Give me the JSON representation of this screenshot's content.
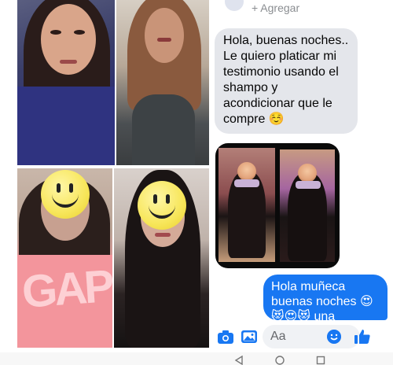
{
  "chat": {
    "add_label": "+ Agregar",
    "incoming_message": "Hola, buenas noches.. Le quiero platicar mi testimonio usando el shampo y acondicionar que le compre ☺️",
    "outgoing_message": "Hola muñeca buenas noches 😍😻😍😻 una",
    "composer_placeholder": "Aa"
  },
  "collage": {
    "shirt_text": "GAP"
  },
  "colors": {
    "messenger_blue": "#1877f2",
    "incoming_bubble": "#e4e6eb"
  },
  "icons": [
    "camera-icon",
    "gallery-icon",
    "emoji-icon",
    "like-icon",
    "nav-back-icon",
    "nav-home-icon",
    "nav-recents-icon"
  ]
}
